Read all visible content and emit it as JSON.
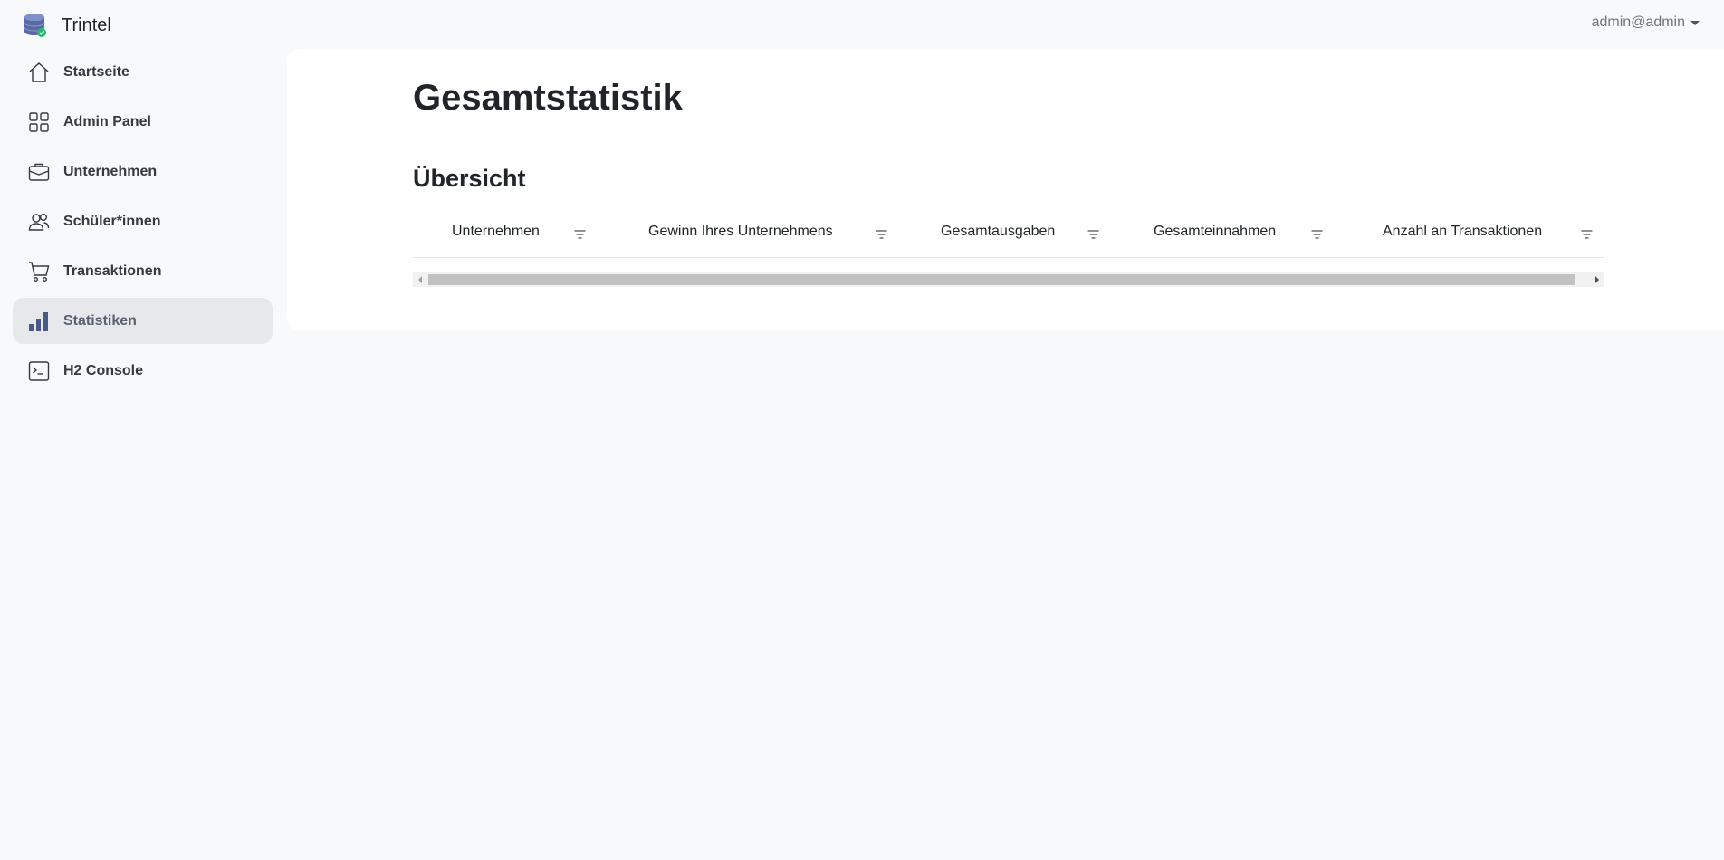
{
  "app": {
    "name": "Trintel"
  },
  "user": {
    "label": "admin@admin"
  },
  "sidebar": {
    "items": [
      {
        "label": "Startseite",
        "icon": "home-icon"
      },
      {
        "label": "Admin Panel",
        "icon": "grid-icon"
      },
      {
        "label": "Unternehmen",
        "icon": "briefcase-icon"
      },
      {
        "label": "Schüler*innen",
        "icon": "users-icon"
      },
      {
        "label": "Transaktionen",
        "icon": "cart-icon"
      },
      {
        "label": "Statistiken",
        "icon": "bar-chart-icon",
        "active": true
      },
      {
        "label": "H2 Console",
        "icon": "terminal-icon"
      }
    ]
  },
  "main": {
    "title": "Gesamtstatistik",
    "section_title": "Übersicht",
    "table": {
      "columns": [
        "Unternehmen",
        "Gewinn Ihres Unternehmens",
        "Gesamtausgaben",
        "Gesamteinnahmen",
        "Anzahl an Transaktionen"
      ],
      "rows": []
    }
  },
  "colors": {
    "background": "#f8f9fa",
    "active_nav": "#e7e8ec",
    "panel": "#ffffff"
  }
}
